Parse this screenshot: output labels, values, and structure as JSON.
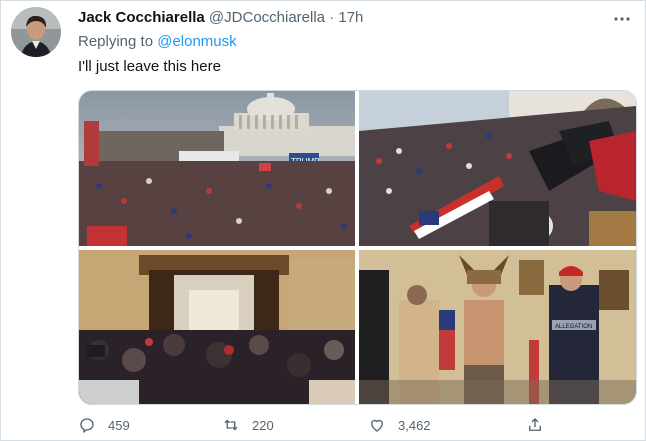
{
  "tweet": {
    "author_name": "Jack Cocchiarella",
    "author_handle": "@JDCocchiarella",
    "separator": "·",
    "time": "17h",
    "more_icon": "more-icon",
    "replying_prefix": "Replying to",
    "replying_to": "@elonmusk",
    "text": "I'll just leave this here"
  },
  "media": {
    "photos": [
      {
        "name": "capitol-crowd-photo"
      },
      {
        "name": "crowd-climbing-steps-photo"
      },
      {
        "name": "capitol-doorway-photo"
      },
      {
        "name": "capitol-interior-photo",
        "sign_text": "ALLEGATION"
      }
    ],
    "banner_text": "TRUMP"
  },
  "actions": {
    "reply_count": "459",
    "retweet_count": "220",
    "like_count": "3,462",
    "icons": [
      "reply-icon",
      "retweet-icon",
      "like-icon",
      "share-icon"
    ]
  },
  "colors": {
    "accent": "#1d9bf0",
    "muted": "#536471",
    "text": "#0f1419"
  }
}
